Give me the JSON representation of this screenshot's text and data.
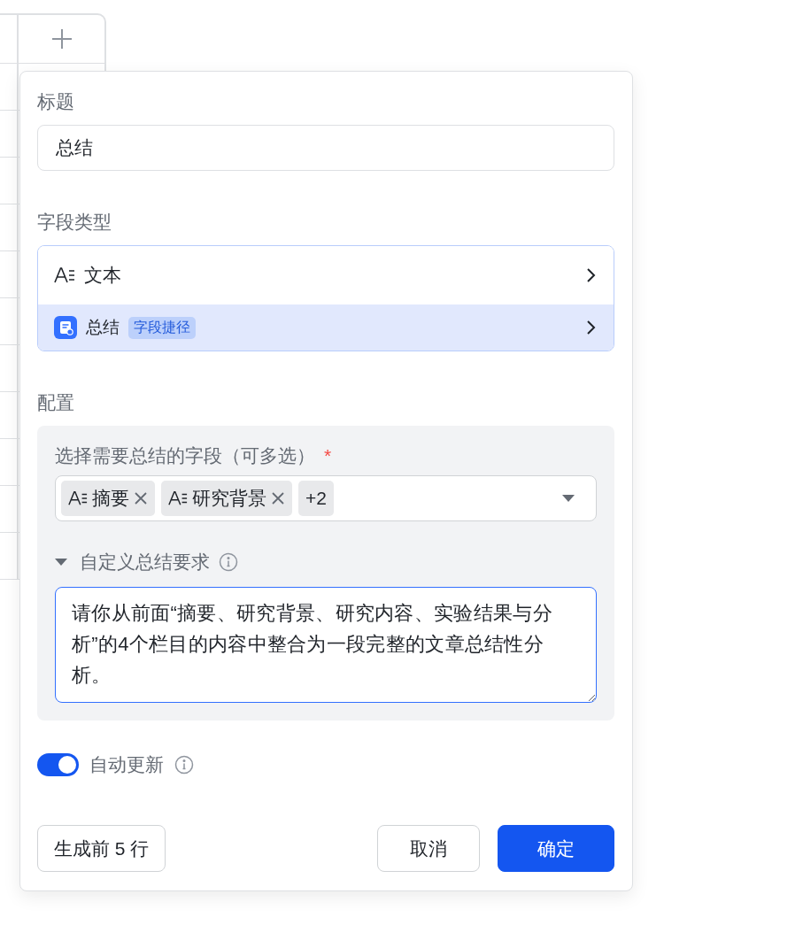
{
  "dialog": {
    "title_label": "标题",
    "title_value": "总结",
    "field_type_label": "字段类型",
    "field_types": [
      {
        "kind": "text",
        "label": "文本",
        "selected": false
      },
      {
        "kind": "summary",
        "label": "总结",
        "badge": "字段捷径",
        "selected": true
      }
    ],
    "config_label": "配置",
    "fields_select": {
      "label": "选择需要总结的字段（可多选）",
      "required_mark": "*",
      "tags": [
        {
          "kind": "field",
          "label": "摘要"
        },
        {
          "kind": "field",
          "label": "研究背景"
        },
        {
          "kind": "more",
          "label": "+2"
        }
      ]
    },
    "custom_requirement": {
      "label": "自定义总结要求",
      "expanded": true,
      "value": "请你从前面“摘要、研究背景、研究内容、实验结果与分析”的4个栏目的内容中整合为一段完整的文章总结性分析。"
    },
    "auto_update": {
      "label": "自动更新",
      "on": true
    },
    "buttons": [
      {
        "kind": "secondary",
        "label": "生成前 5 行"
      },
      {
        "kind": "secondary",
        "label": "取消"
      },
      {
        "kind": "primary",
        "label": "确定"
      }
    ]
  }
}
